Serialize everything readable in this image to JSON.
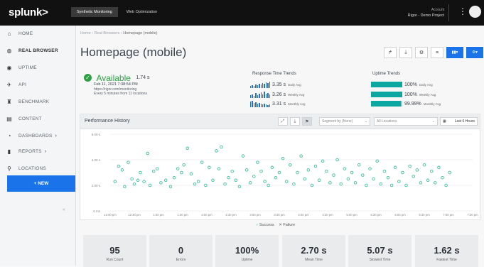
{
  "app": {
    "logo": "splunk>"
  },
  "topnav": {
    "tabs": [
      "Synthetic Monitoring",
      "Web Optimization"
    ]
  },
  "account": {
    "label": "Account",
    "project": "Rigor - Demo Project"
  },
  "sidebar": {
    "items": [
      {
        "label": "HOME",
        "icon": "home-icon"
      },
      {
        "label": "REAL BROWSER",
        "icon": "globe-icon"
      },
      {
        "label": "UPTIME",
        "icon": "circle-icon"
      },
      {
        "label": "API",
        "icon": "api-icon"
      },
      {
        "label": "BENCHMARK",
        "icon": "trophy-icon"
      },
      {
        "label": "CONTENT",
        "icon": "document-icon"
      },
      {
        "label": "DASHBOARDS",
        "icon": "dashboard-icon"
      },
      {
        "label": "REPORTS",
        "icon": "bar-chart-icon"
      },
      {
        "label": "LOCATIONS",
        "icon": "location-pin-icon"
      }
    ],
    "new_label": "+ NEW"
  },
  "breadcrumb": {
    "parts": [
      "Home",
      "Real Browsers"
    ],
    "current": "Homepage (mobile)"
  },
  "page": {
    "title": "Homepage (mobile)"
  },
  "toolbar": {
    "chart_label": "▾"
  },
  "status": {
    "word": "Available",
    "value": "1.74 s",
    "date": "Feb 11, 2021 7:38:54 PM",
    "url": "https://rigor.com/monitoring",
    "frequency": "Every 5 minutes from 11 locations"
  },
  "response_trends": {
    "title": "Response Time Trends",
    "rows": [
      {
        "value": "3.35 s",
        "label": "Daily Avg"
      },
      {
        "value": "3.26 s",
        "label": "Weekly Avg"
      },
      {
        "value": "3.31 s",
        "label": "Monthly Avg"
      }
    ]
  },
  "uptime_trends": {
    "title": "Uptime Trends",
    "rows": [
      {
        "value": "100%",
        "label": "Daily Avg",
        "fraction": 1.0
      },
      {
        "value": "100%",
        "label": "Weekly Avg",
        "fraction": 1.0
      },
      {
        "value": "99.99%",
        "label": "Monthly Avg",
        "fraction": 0.9999
      }
    ]
  },
  "perf": {
    "title": "Performance History",
    "segment_placeholder": "Segment by (None)",
    "locations_placeholder": "All Locations",
    "range_label": "Last 6 Hours",
    "legend_success": "Success",
    "legend_failure": "Failure"
  },
  "colors": {
    "success": "#3cc29a",
    "primary": "#1a73e8",
    "available": "#2ea043",
    "uptime": "#0aa8a0",
    "spark": "#2f6fbf"
  },
  "chart_data": {
    "type": "scatter",
    "title": "",
    "xlabel": "",
    "ylabel": "",
    "yticks": [
      "0 ms",
      "2.00 s",
      "4.00 s",
      "6.00 s"
    ],
    "ylim": [
      0,
      6
    ],
    "xticks": [
      "12:00 pm",
      "12:30 pm",
      "1:00 pm",
      "1:30 pm",
      "2:00 pm",
      "2:30 pm",
      "3:00 pm",
      "3:30 pm",
      "4:00 pm",
      "4:30 pm",
      "5:00 pm",
      "5:30 pm",
      "6:00 pm",
      "6:30 pm",
      "7:00 pm",
      "7:30 pm"
    ],
    "grid": true,
    "legend": "bottom",
    "series": [
      {
        "name": "Success",
        "points": [
          [
            0.2,
            2.3
          ],
          [
            0.35,
            3.5
          ],
          [
            0.5,
            3.2
          ],
          [
            0.6,
            1.9
          ],
          [
            0.75,
            3.8
          ],
          [
            0.9,
            2.5
          ],
          [
            1.0,
            2.1
          ],
          [
            1.15,
            2.4
          ],
          [
            1.25,
            3.0
          ],
          [
            1.4,
            2.3
          ],
          [
            1.55,
            4.5
          ],
          [
            1.65,
            2.0
          ],
          [
            1.8,
            3.1
          ],
          [
            1.95,
            3.3
          ],
          [
            2.1,
            2.2
          ],
          [
            2.3,
            2.4
          ],
          [
            2.5,
            1.9
          ],
          [
            2.65,
            2.6
          ],
          [
            2.8,
            3.3
          ],
          [
            2.95,
            3.0
          ],
          [
            3.05,
            3.6
          ],
          [
            3.2,
            4.9
          ],
          [
            3.35,
            2.9
          ],
          [
            3.5,
            2.1
          ],
          [
            3.65,
            2.3
          ],
          [
            3.8,
            3.8
          ],
          [
            3.95,
            2.0
          ],
          [
            4.1,
            3.4
          ],
          [
            4.25,
            2.4
          ],
          [
            4.4,
            4.7
          ],
          [
            4.5,
            3.3
          ],
          [
            4.6,
            5.0
          ],
          [
            4.75,
            2.1
          ],
          [
            4.9,
            2.6
          ],
          [
            5.05,
            3.1
          ],
          [
            5.2,
            2.4
          ],
          [
            5.35,
            1.9
          ],
          [
            5.5,
            4.3
          ],
          [
            5.65,
            3.2
          ],
          [
            5.8,
            2.2
          ],
          [
            5.95,
            2.7
          ],
          [
            6.1,
            3.8
          ],
          [
            6.25,
            3.1
          ],
          [
            6.4,
            2.3
          ],
          [
            6.55,
            2.0
          ],
          [
            6.7,
            3.4
          ],
          [
            6.85,
            2.6
          ],
          [
            7.0,
            3.0
          ],
          [
            7.15,
            4.1
          ],
          [
            7.3,
            2.3
          ],
          [
            7.45,
            3.6
          ],
          [
            7.6,
            2.1
          ],
          [
            7.75,
            3.0
          ],
          [
            7.9,
            4.3
          ],
          [
            8.05,
            2.5
          ],
          [
            8.2,
            3.2
          ],
          [
            8.35,
            2.0
          ],
          [
            8.5,
            3.5
          ],
          [
            8.65,
            2.4
          ],
          [
            8.8,
            3.9
          ],
          [
            8.95,
            3.1
          ],
          [
            9.1,
            2.2
          ],
          [
            9.25,
            2.8
          ],
          [
            9.4,
            4.0
          ],
          [
            9.55,
            2.1
          ],
          [
            9.7,
            3.3
          ],
          [
            9.85,
            2.5
          ],
          [
            10.0,
            3.0
          ],
          [
            10.15,
            2.2
          ],
          [
            10.3,
            3.6
          ],
          [
            10.45,
            2.8
          ],
          [
            10.6,
            2.0
          ],
          [
            10.75,
            3.3
          ],
          [
            10.9,
            2.5
          ],
          [
            11.05,
            3.9
          ],
          [
            11.2,
            2.1
          ],
          [
            11.35,
            3.1
          ],
          [
            11.5,
            2.6
          ],
          [
            11.65,
            2.0
          ],
          [
            11.8,
            3.4
          ],
          [
            11.95,
            2.3
          ],
          [
            12.1,
            3.0
          ],
          [
            12.25,
            2.0
          ],
          [
            12.4,
            3.5
          ],
          [
            12.55,
            2.7
          ],
          [
            12.7,
            3.2
          ],
          [
            12.85,
            2.2
          ],
          [
            13.0,
            3.6
          ],
          [
            13.15,
            2.4
          ],
          [
            13.3,
            3.1
          ],
          [
            13.45,
            2.2
          ],
          [
            13.6,
            3.4
          ],
          [
            13.75,
            2.6
          ],
          [
            13.9,
            2.0
          ],
          [
            14.05,
            3.0
          ]
        ]
      },
      {
        "name": "Failure",
        "points": []
      }
    ]
  },
  "stats": [
    {
      "value": "95",
      "label": "Run Count"
    },
    {
      "value": "0",
      "label": "Errors"
    },
    {
      "value": "100%",
      "label": "Uptime"
    },
    {
      "value": "2.70 s",
      "label": "Mean Time"
    },
    {
      "value": "5.07 s",
      "label": "Slowest Time"
    },
    {
      "value": "1.62 s",
      "label": "Fastest Time"
    }
  ]
}
